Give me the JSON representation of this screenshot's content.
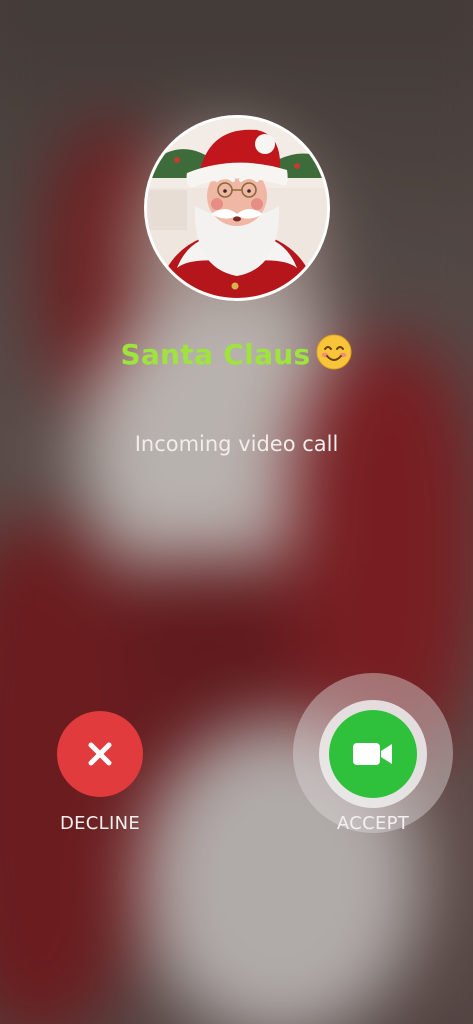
{
  "call": {
    "caller_name": "Santa Claus",
    "caller_emoji": "smiling-face-with-smiling-eyes",
    "status": "Incoming video call"
  },
  "actions": {
    "decline_label": "DECLINE",
    "accept_label": "ACCEPT"
  },
  "colors": {
    "name": "#9fe33f",
    "decline": "#e13b3d",
    "accept": "#2fc13c"
  }
}
